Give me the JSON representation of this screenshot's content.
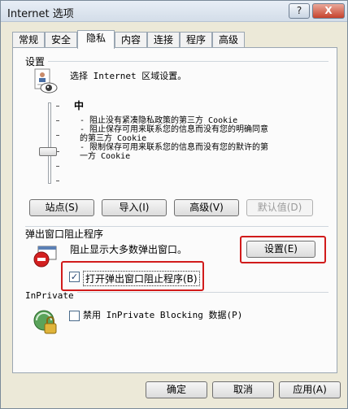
{
  "window": {
    "title": "Internet 选项",
    "help_label": "?",
    "close_label": "X"
  },
  "tabs": [
    {
      "label": "常规"
    },
    {
      "label": "安全"
    },
    {
      "label": "隐私",
      "active": true
    },
    {
      "label": "内容"
    },
    {
      "label": "连接"
    },
    {
      "label": "程序"
    },
    {
      "label": "高级"
    }
  ],
  "settings": {
    "group_label": "设置",
    "instruction": "选择 Internet 区域设置。",
    "level": "中",
    "description_lines": [
      "- 阻止没有紧凑隐私政策的第三方 Cookie",
      "- 阻止保存可用来联系您的信息而没有您的明确同意",
      "的第三方 Cookie",
      "- 限制保存可用来联系您的信息而没有您的默许的第",
      "一方 Cookie"
    ],
    "buttons": {
      "sites": "站点(S)",
      "import": "导入(I)",
      "advanced": "高级(V)",
      "default": "默认值(D)"
    }
  },
  "popup_blocker": {
    "group_label": "弹出窗口阻止程序",
    "description": "阻止显示大多数弹出窗口。",
    "settings_button": "设置(E)",
    "enable_label": "打开弹出窗口阻止程序(B)",
    "enabled": true
  },
  "inprivate": {
    "group_label": "InPrivate",
    "checkbox_label": "禁用 InPrivate Blocking 数据(P)",
    "checked": false
  },
  "footer": {
    "ok": "确定",
    "cancel": "取消",
    "apply": "应用(A)"
  },
  "colors": {
    "highlight_box": "#d11b1b"
  }
}
